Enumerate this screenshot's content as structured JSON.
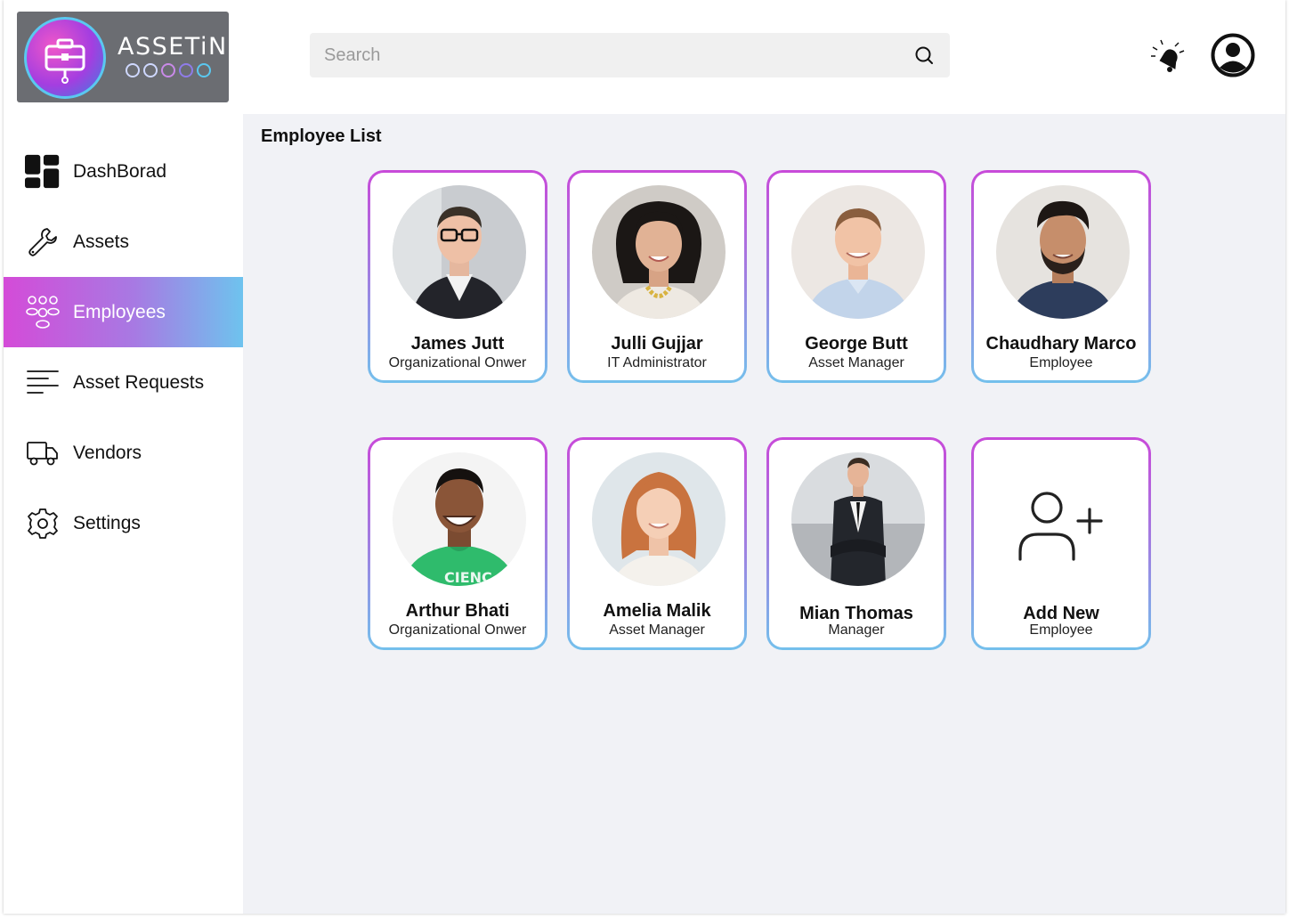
{
  "brand": {
    "name": "ASSETiN"
  },
  "search": {
    "placeholder": "Search"
  },
  "sidebar": {
    "items": [
      {
        "label": "DashBorad",
        "icon": "dashboard-icon",
        "active": false
      },
      {
        "label": "Assets",
        "icon": "wrench-icon",
        "active": false
      },
      {
        "label": "Employees",
        "icon": "people-icon",
        "active": true
      },
      {
        "label": "Asset Requests",
        "icon": "list-icon",
        "active": false
      },
      {
        "label": "Vendors",
        "icon": "truck-icon",
        "active": false
      },
      {
        "label": "Settings",
        "icon": "gear-icon",
        "active": false
      }
    ]
  },
  "main": {
    "title": "Employee List",
    "employees": [
      {
        "name": "James Jutt",
        "role": "Organizational Onwer"
      },
      {
        "name": "Julli Gujjar",
        "role": "IT Administrator"
      },
      {
        "name": "George Butt",
        "role": "Asset Manager"
      },
      {
        "name": "Chaudhary Marco",
        "role": "Employee"
      },
      {
        "name": "Arthur Bhati",
        "role": "Organizational Onwer"
      },
      {
        "name": "Amelia Malik",
        "role": "Asset Manager"
      },
      {
        "name": "Mian Thomas",
        "role": "Manager"
      }
    ],
    "add_card": {
      "title": "Add New",
      "subtitle": "Employee"
    }
  },
  "colors": {
    "accent_start": "#d44bd8",
    "accent_end": "#6ec3ee",
    "main_bg": "#f1f2f6"
  }
}
